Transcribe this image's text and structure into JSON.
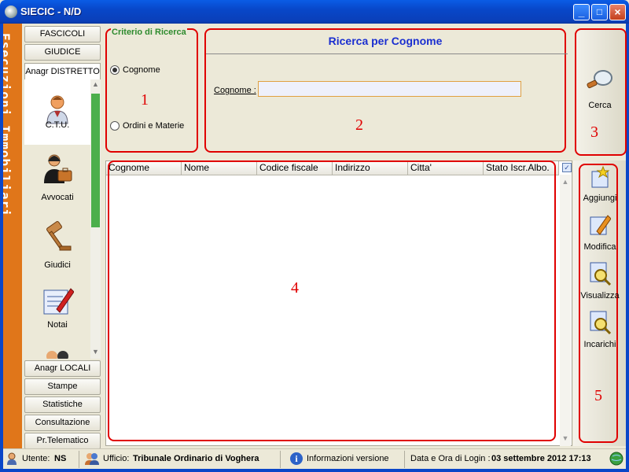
{
  "window": {
    "title": "SIECIC - N/D"
  },
  "sidebar": {
    "vertical_title": "Esecuzioni Immobiliari",
    "top_buttons": [
      "FASCICOLI",
      "GIUDICE"
    ],
    "active_tab": "Anagr DISTRETTO",
    "items": [
      {
        "label": "C.T.U.",
        "icon": "ctu-person-icon"
      },
      {
        "label": "Avvocati",
        "icon": "lawyer-icon"
      },
      {
        "label": "Giudici",
        "icon": "gavel-icon"
      },
      {
        "label": "Notai",
        "icon": "notary-pen-icon"
      }
    ],
    "bottom_buttons": [
      "Anagr LOCALI",
      "Stampe",
      "Statistiche",
      "Consultazione",
      "Pr.Telematico"
    ]
  },
  "criteria": {
    "title": "Criterio di Ricerca",
    "options": [
      {
        "label": "Cognome",
        "selected": true
      },
      {
        "label": "Ordini e Materie",
        "selected": false
      }
    ]
  },
  "search": {
    "title": "Ricerca per Cognome",
    "field_label": "Cognome :",
    "field_value": ""
  },
  "search_button": {
    "label": "Cerca"
  },
  "table": {
    "columns": [
      "Cognome",
      "Nome",
      "Codice fiscale",
      "Indirizzo",
      "Citta'",
      "Stato Iscr.Albo."
    ],
    "rows": []
  },
  "actions": [
    "Aggiungi",
    "Modifica",
    "Visualizza",
    "Incarichi"
  ],
  "annotations": [
    "1",
    "2",
    "3",
    "4",
    "5"
  ],
  "status": {
    "user_label": "Utente:",
    "user_value": "NS",
    "office_label": "Ufficio:",
    "office_value": "Tribunale Ordinario di Voghera",
    "info": "Informazioni versione",
    "login_label": "Data e Ora di Login :",
    "login_value": "03 settembre 2012 17:13"
  },
  "colors": {
    "accent": "#e00000",
    "section_title": "#2e8b2e",
    "heading_blue": "#1a2ed0",
    "sidebar_strip": "#e0761a"
  }
}
